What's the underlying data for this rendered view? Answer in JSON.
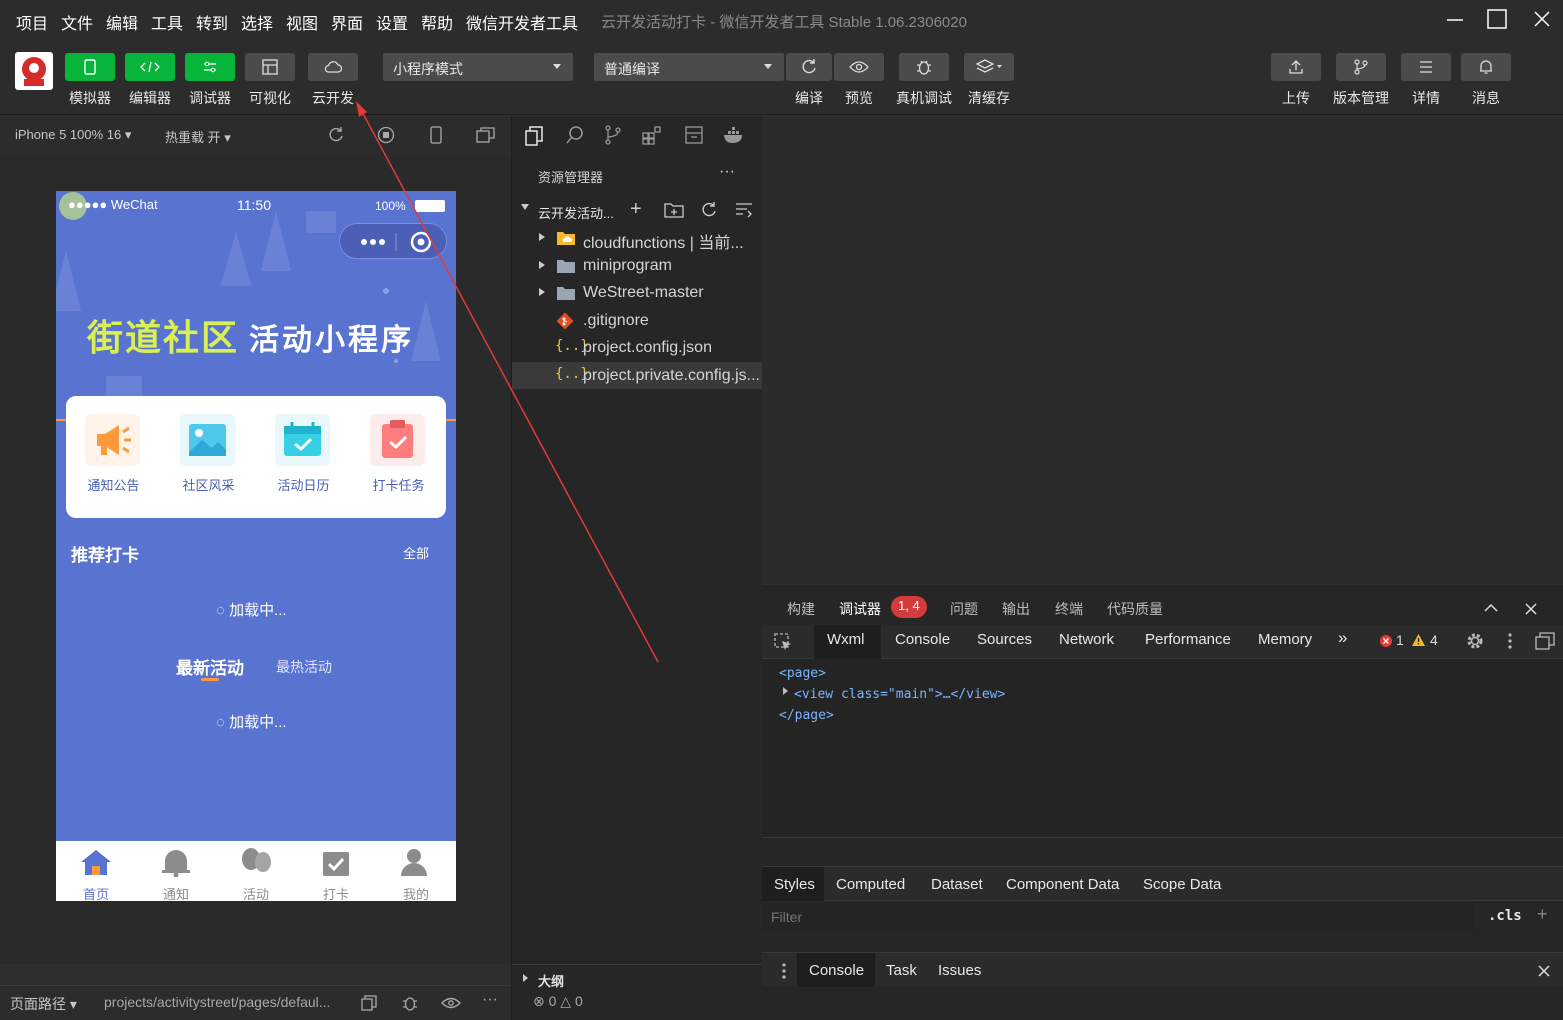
{
  "menubar": {
    "items": [
      "项目",
      "文件",
      "编辑",
      "工具",
      "转到",
      "选择",
      "视图",
      "界面",
      "设置",
      "帮助",
      "微信开发者工具"
    ],
    "window_title": "云开发活动打卡 - 微信开发者工具 Stable 1.06.2306020"
  },
  "toolbar": {
    "left_buttons": [
      "模拟器",
      "编辑器",
      "调试器",
      "可视化",
      "云开发"
    ],
    "mode_select": "小程序模式",
    "compile_select": "普通编译",
    "mid_buttons": [
      "编译",
      "预览",
      "真机调试",
      "清缓存"
    ],
    "right_buttons": [
      "上传",
      "版本管理",
      "详情",
      "消息"
    ],
    "accent": "#07b53b"
  },
  "simbar": {
    "device": "iPhone 5 100% 16 ▾",
    "hotreload": "热重载 开 ▾"
  },
  "phone": {
    "status": {
      "carrier": "●●●●● WeChat",
      "time": "11:50",
      "battery": "100%"
    },
    "banner_title_a": "街道社区",
    "banner_title_b": "活动小程序",
    "grid": [
      "通知公告",
      "社区风采",
      "活动日历",
      "打卡任务"
    ],
    "recommend": {
      "title": "推荐打卡",
      "all": "全部"
    },
    "loading": "加载中...",
    "tabs": [
      "最新活动",
      "最热活动"
    ],
    "nav": [
      "首页",
      "通知",
      "活动",
      "打卡",
      "我的"
    ],
    "bg": "#5973d0"
  },
  "simstatus": {
    "path_label": "页面路径 ▾",
    "path": "projects/activitystreet/pages/defaul..."
  },
  "explorer": {
    "title": "资源管理器",
    "more": "···",
    "project": "云开发活动...",
    "items": [
      {
        "name": "cloudfunctions | 当前...",
        "icon": "folder-cloud-icon"
      },
      {
        "name": "miniprogram",
        "icon": "folder-icon"
      },
      {
        "name": "WeStreet-master",
        "icon": "folder-icon"
      },
      {
        "name": ".gitignore",
        "icon": "git-icon"
      },
      {
        "name": "project.config.json",
        "icon": "json-icon"
      },
      {
        "name": "project.private.config.js...",
        "icon": "json-icon"
      }
    ],
    "outline": "大纲",
    "problems": "⊗ 0 △ 0"
  },
  "debug": {
    "top_tabs": [
      "构建",
      "调试器",
      "问题",
      "输出",
      "终端",
      "代码质量"
    ],
    "badge": "1, 4",
    "devtools_tabs": [
      "Wxml",
      "Console",
      "Sources",
      "Network",
      "Performance",
      "Memory"
    ],
    "more": "»",
    "errors": "1",
    "warnings": "4",
    "code": [
      "<page>",
      "<view class=\"main\">…</view>",
      "</page>"
    ],
    "style_tabs": [
      "Styles",
      "Computed",
      "Dataset",
      "Component Data",
      "Scope Data"
    ],
    "filter_placeholder": "Filter",
    "cls": ".cls",
    "plus": "+",
    "drawer_tabs": [
      "Console",
      "Task",
      "Issues"
    ]
  }
}
